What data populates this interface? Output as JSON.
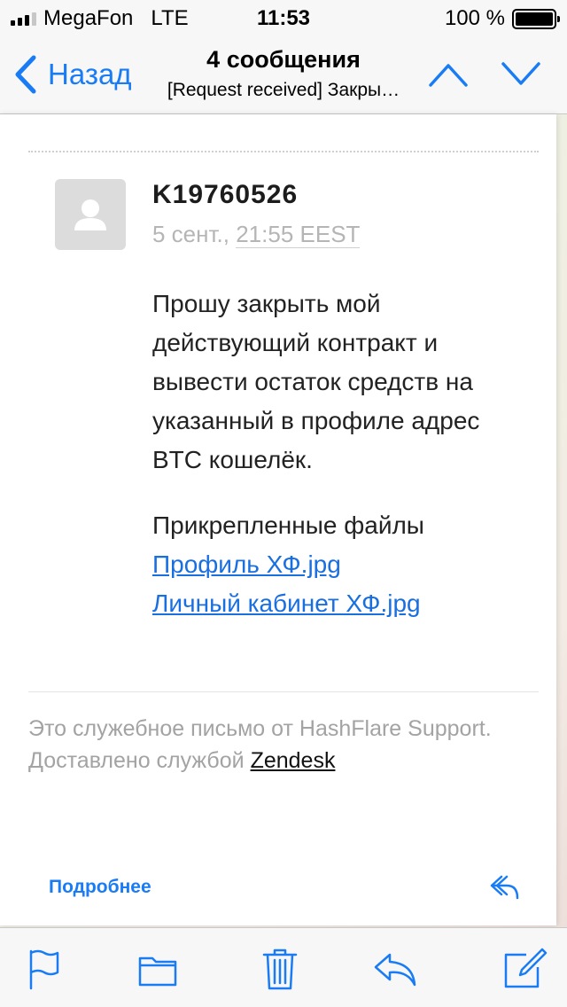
{
  "status_bar": {
    "carrier": "MegaFon",
    "network": "LTE",
    "time": "11:53",
    "battery_percent": "100 %",
    "battery_level": 1.0,
    "signal_bars": 3,
    "signal_bars_total": 4
  },
  "nav": {
    "back_label": "Назад",
    "title": "4 сообщения",
    "subtitle": "[Request received] Закры…",
    "icons": [
      "chevron-left-icon",
      "chevron-up-icon",
      "chevron-down-icon"
    ],
    "accent_color": "#1a7cf5"
  },
  "message": {
    "sender": "K19760526",
    "date_day": "5 сент.,",
    "date_time": "21:55 EEST",
    "body_lines": [
      "Прошу закрыть мой",
      "действующий контракт и",
      "вывести остаток средств на",
      "указанный в профиле адрес",
      "BTC кошелёк."
    ],
    "attachments_title": "Прикрепленные файлы",
    "attachments": [
      "Профиль ХФ.jpg",
      "Личный кабинет ХФ.jpg"
    ],
    "link_color": "#1a6fe0"
  },
  "footer": {
    "line1": "Это служебное письмо от HashFlare Support.",
    "line2_prefix": "Доставлено службой",
    "line2_link": "Zendesk"
  },
  "card_actions": {
    "more_label": "Подробнее",
    "reply_icon": "reply-icon"
  },
  "toolbar": {
    "icons": [
      "flag-icon",
      "folder-icon",
      "trash-icon",
      "reply-icon",
      "compose-icon"
    ]
  }
}
